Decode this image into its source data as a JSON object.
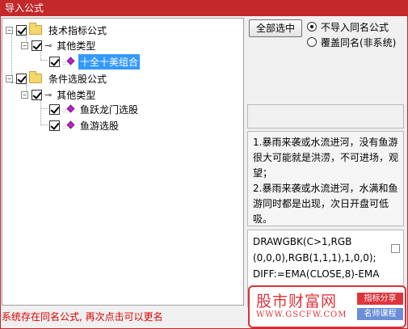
{
  "window": {
    "title": "导入公式"
  },
  "tree": {
    "nodes": [
      {
        "label": "技术指标公式",
        "checked": true,
        "icon": "folder-icon"
      },
      {
        "label": "其他类型",
        "checked": true,
        "icon": "key-icon"
      },
      {
        "label": "十全十美组合",
        "checked": true,
        "icon": "formula-icon",
        "selected": true
      },
      {
        "label": "条件选股公式",
        "checked": true,
        "icon": "folder-icon"
      },
      {
        "label": "其他类型",
        "checked": true,
        "icon": "key-icon"
      },
      {
        "label": "鱼跃龙门选股",
        "checked": true,
        "icon": "formula-icon"
      },
      {
        "label": "鱼游选股",
        "checked": true,
        "icon": "formula-icon"
      }
    ],
    "expander_glyph": "−"
  },
  "controls": {
    "select_all": "全部选中",
    "radio_no_import": "不导入同名公式",
    "radio_overwrite": "覆盖同名(非系统)",
    "selected_radio": "no_import"
  },
  "description": {
    "line1": "1.暴雨来袭或水流进河，没有鱼游很大可能就是洪涝，不可进场，观望；",
    "line2": "2.暴雨来袭或水流进河，水满和鱼游同时都是出现，次日开盘可低吸。"
  },
  "code": {
    "lines": [
      "DRAWGBK(C>1,RGB",
      "(0,0,0),RGB(1,1,1),1,0,0);",
      "",
      "DIFF:=EMA(CLOSE,8)-EMA"
    ]
  },
  "footer": {
    "message": "系统存在同名公式, 再次点击可以更名"
  },
  "watermark": {
    "title": "股市财富网",
    "url": "WWW.GSCFW.COM",
    "tag1": "指标分享",
    "tag2": "名师课程"
  },
  "colors": {
    "titlebar": "#c3282a",
    "selection": "#3399ff",
    "footer_text": "#e00000",
    "watermark_red": "#e0343c",
    "watermark_blue": "#6a8fd6",
    "formula_gem": "#c01fd0"
  }
}
